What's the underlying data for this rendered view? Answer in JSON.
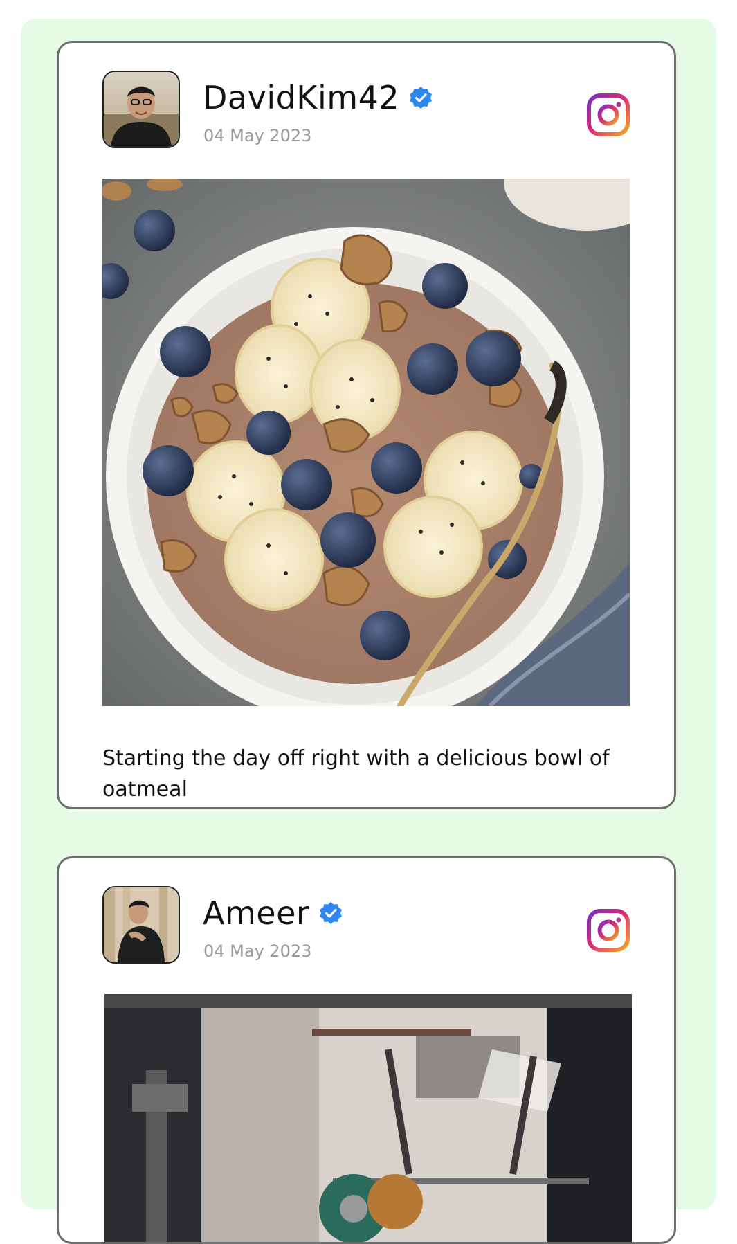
{
  "posts": [
    {
      "username": "DavidKim42",
      "date": "04 May 2023",
      "caption": "Starting the day off right with a delicious bowl of oatmeal",
      "verified": true,
      "platform_icon": "instagram-icon",
      "verified_color": "#2e86f0"
    },
    {
      "username": "Ameer",
      "date": "04 May 2023",
      "caption": "",
      "verified": true,
      "platform_icon": "instagram-icon",
      "verified_color": "#2e86f0"
    }
  ],
  "colors": {
    "feed_background": "#e6fbe6",
    "card_border": "#6f6f6f",
    "date_text": "#9a9a9a"
  }
}
